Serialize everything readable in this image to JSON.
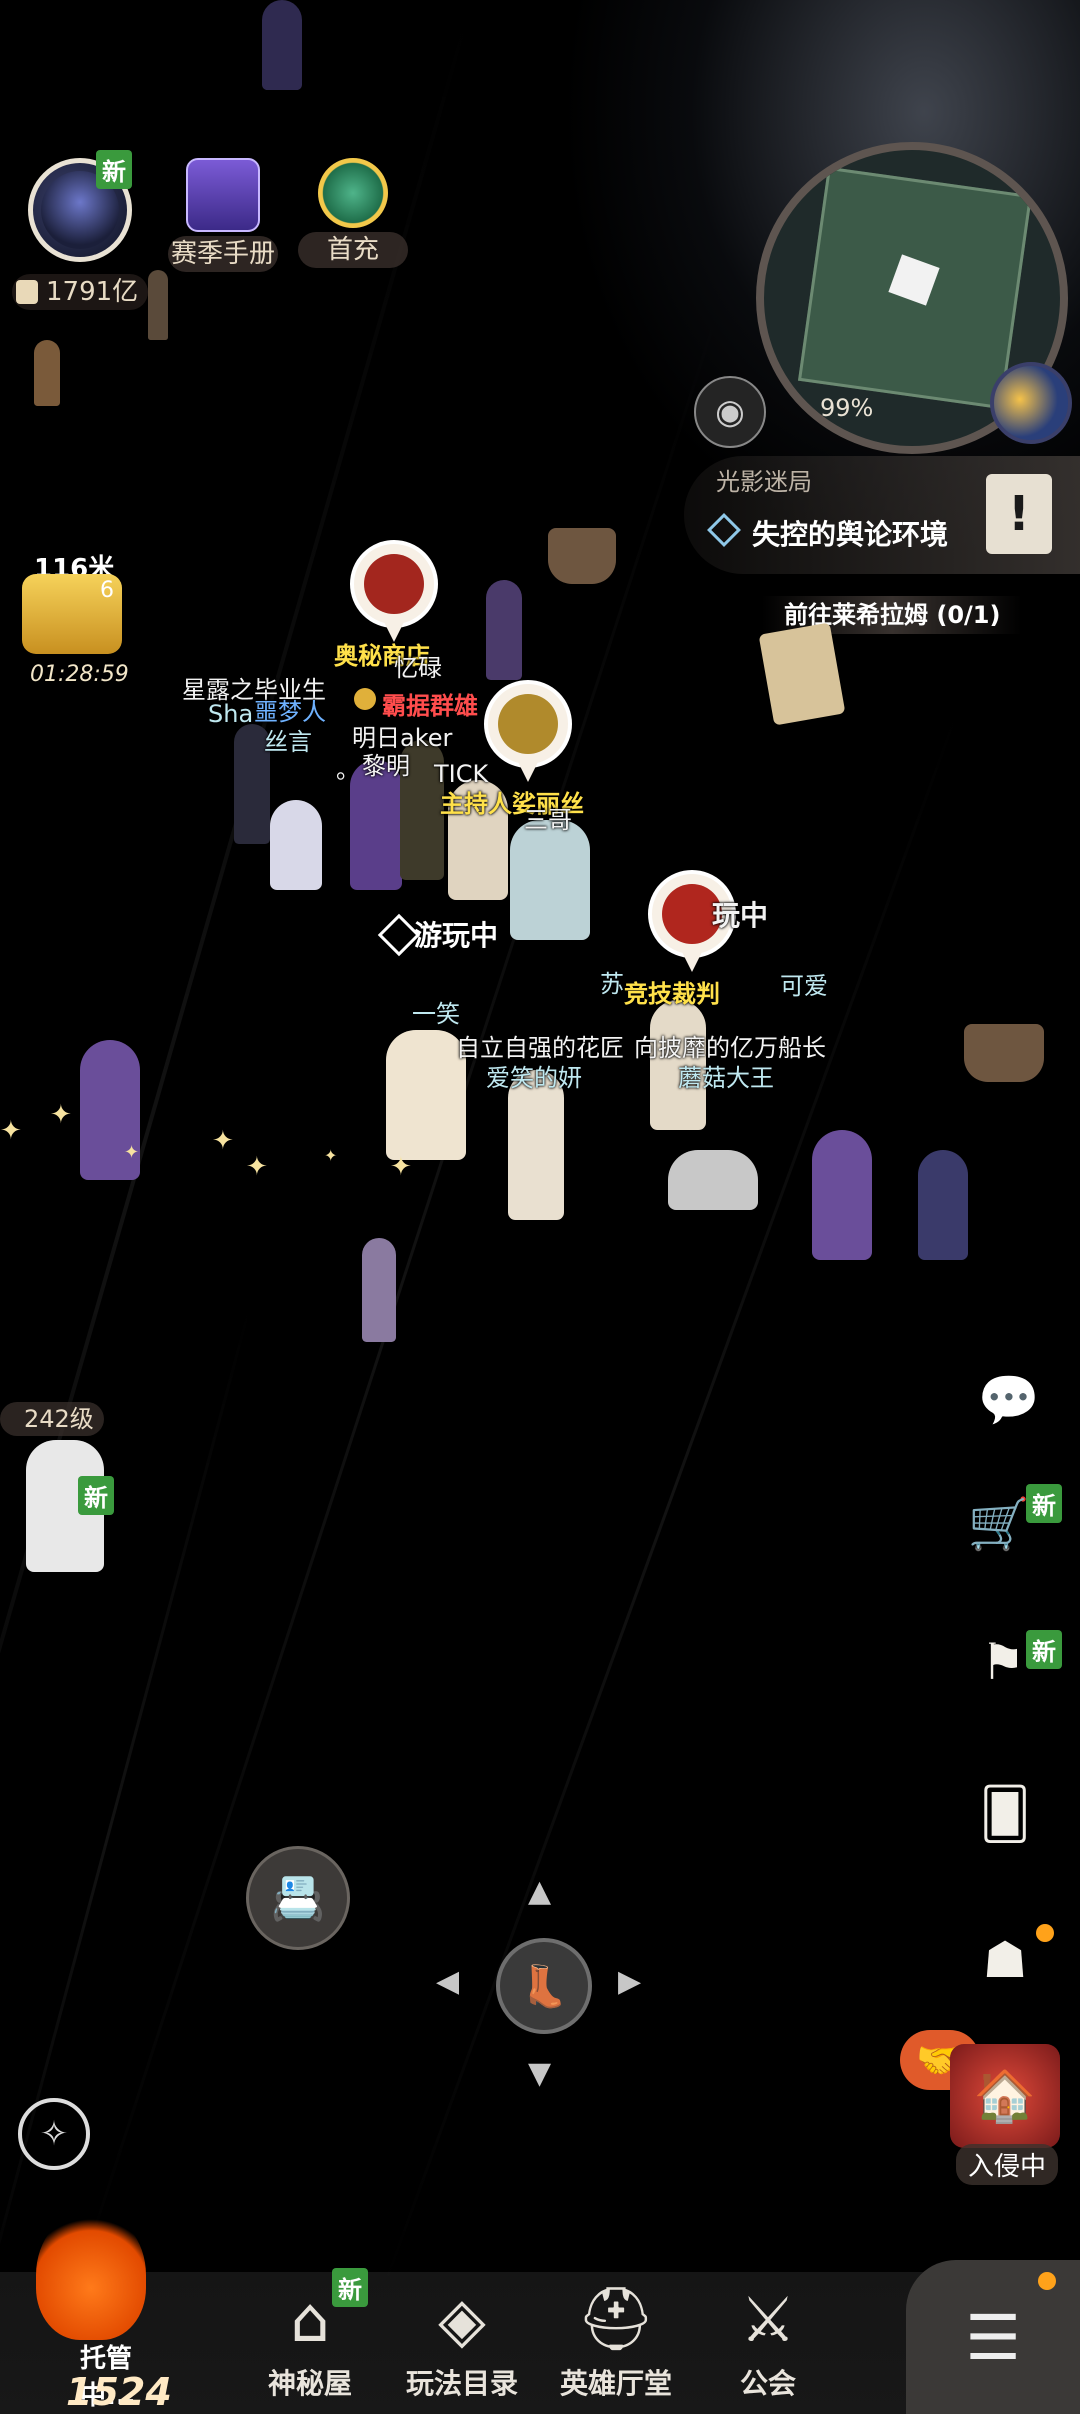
{
  "hud": {
    "avatar_new": "新",
    "currency": "1791亿",
    "season_label": "赛季手册",
    "first_charge_label": "首充"
  },
  "minimap": {
    "percent": "99%"
  },
  "quest": {
    "category": "光影迷局",
    "title": "失控的舆论环境",
    "book_icon": "!",
    "subtitle": "前往莱希拉姆 (0/1)"
  },
  "event": {
    "distance": "116米",
    "count": "6",
    "timer": "01:28:59"
  },
  "players": {
    "n1": "星露之毕业生",
    "n2": "Sha",
    "n3": "噩梦人",
    "n4": "丝言",
    "n5": "奥秘商店",
    "n6": "忆碌",
    "n7": "霸据群雄",
    "n8": "明日aker",
    "n9": "黎明",
    "n10": "TICK",
    "n11": "主持人娑丽丝",
    "n12": "三哥",
    "n13": "游玩中",
    "n14": "玩中",
    "n15": "苏",
    "n16": "竞技裁判",
    "n17": "可爱",
    "n18": "一笑",
    "n19": "自立自强的花匠",
    "n20": "向披靡的亿万船长",
    "n21": "爱笑的妍",
    "n22": "蘑菇大王",
    "n23": "。"
  },
  "left_player": {
    "level": "242级",
    "new": "新"
  },
  "right_menu": {
    "chat_new": "新",
    "gift_new": "新",
    "invade_label": "入侵中"
  },
  "bottom_nav": {
    "hosting_label": "托管中...",
    "hosting_value": "1524",
    "items": [
      {
        "label": "神秘屋",
        "new": "新"
      },
      {
        "label": "玩法目录"
      },
      {
        "label": "英雄厅堂"
      },
      {
        "label": "公会"
      }
    ]
  }
}
